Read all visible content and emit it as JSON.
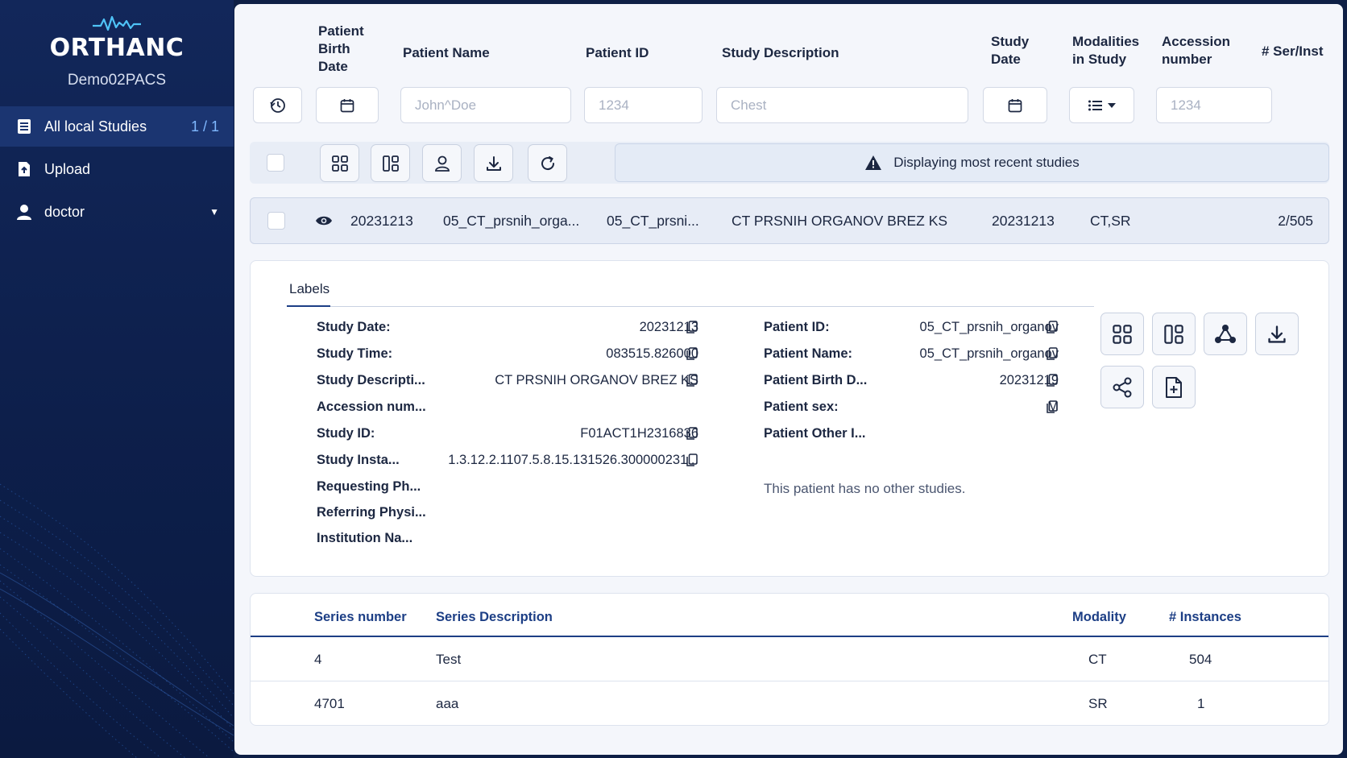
{
  "sidebar": {
    "brand": "ORTHANC",
    "server_name": "Demo02PACS",
    "items": [
      {
        "label": "All local Studies",
        "count": "1 / 1"
      },
      {
        "label": "Upload"
      },
      {
        "label": "doctor"
      }
    ]
  },
  "columns": {
    "birth_date": "Patient Birth Date",
    "patient_name": "Patient Name",
    "patient_id": "Patient ID",
    "study_description": "Study Description",
    "study_date": "Study Date",
    "modalities": "Modalities in Study",
    "accession": "Accession number",
    "ser_inst": "# Ser/Inst"
  },
  "filters": {
    "patient_name_placeholder": "John^Doe",
    "patient_id_placeholder": "1234",
    "study_description_placeholder": "Chest",
    "accession_placeholder": "1234"
  },
  "notice": "Displaying most recent studies",
  "study": {
    "birth_date": "20231213",
    "patient_name": "05_CT_prsnih_orga...",
    "patient_id": "05_CT_prsni...",
    "description": "CT PRSNIH ORGANOV BREZ KS",
    "study_date": "20231213",
    "modalities": "CT,SR",
    "ser_inst": "2/505"
  },
  "details": {
    "tab": "Labels",
    "left": [
      {
        "key": "Study Date:",
        "value": "20231213",
        "copy": true
      },
      {
        "key": "Study Time:",
        "value": "083515.826000",
        "copy": true
      },
      {
        "key": "Study Descripti...",
        "value": "CT PRSNIH ORGANOV BREZ KS",
        "copy": true
      },
      {
        "key": "Accession num...",
        "value": "",
        "copy": false
      },
      {
        "key": "Study ID:",
        "value": "F01ACT1H2316836",
        "copy": true
      },
      {
        "key": "Study Insta...",
        "value": "1.3.12.2.1107.5.8.15.131526.300000231...",
        "copy": true
      },
      {
        "key": "Requesting Ph...",
        "value": "",
        "copy": false
      },
      {
        "key": "Referring Physi...",
        "value": "",
        "copy": false
      },
      {
        "key": "Institution Na...",
        "value": "",
        "copy": false
      }
    ],
    "right": [
      {
        "key": "Patient ID:",
        "value": "05_CT_prsnih_organov",
        "copy": true
      },
      {
        "key": "Patient Name:",
        "value": "05_CT_prsnih_organov",
        "copy": true
      },
      {
        "key": "Patient Birth D...",
        "value": "20231219",
        "copy": true
      },
      {
        "key": "Patient sex:",
        "value": "M",
        "copy": true
      },
      {
        "key": "Patient Other I...",
        "value": "",
        "copy": false
      }
    ],
    "no_other_studies": "This patient has no other studies."
  },
  "series_table": {
    "headers": [
      "Series number",
      "Series Description",
      "Modality",
      "# Instances"
    ],
    "rows": [
      {
        "number": "4",
        "description": "Test",
        "modality": "CT",
        "instances": "504"
      },
      {
        "number": "4701",
        "description": "aaa",
        "modality": "SR",
        "instances": "1"
      }
    ]
  },
  "colors": {
    "sidebar_bg": "#12275a",
    "accent": "#1c3e85",
    "count": "#7fb8ff",
    "panel_bg": "#f4f6fb"
  }
}
